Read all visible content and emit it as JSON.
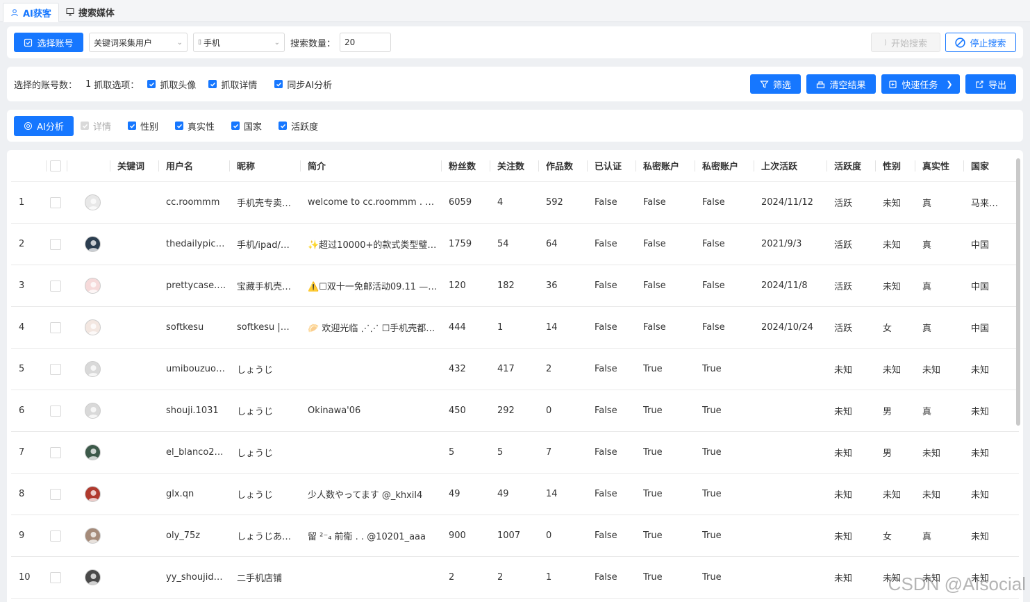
{
  "tabs": [
    {
      "label": "AI获客",
      "icon": "person-icon",
      "active": true
    },
    {
      "label": "搜索媒体",
      "icon": "monitor-icon",
      "active": false
    }
  ],
  "toolbar": {
    "select_account_label": "选择账号",
    "mode_select_value": "关键词采集用户",
    "device_select_value": "手机",
    "search_count_label": "搜索数量：",
    "search_count_value": "20",
    "start_search_label": "开始搜索",
    "stop_search_label": "停止搜索"
  },
  "options": {
    "selected_accounts_label": "选择的账号数：",
    "selected_accounts_value": "1",
    "capture_options_label": "抓取选项：",
    "capture_avatar": "抓取头像",
    "capture_details": "抓取详情",
    "sync_ai": "同步AI分析",
    "filter_label": "筛选",
    "clear_label": "清空结果",
    "quick_task_label": "快速任务",
    "export_label": "导出"
  },
  "ai_bar": {
    "ai_analysis_label": "AI分析",
    "details": "详情",
    "gender": "性别",
    "authenticity": "真实性",
    "country": "国家",
    "activity": "活跃度"
  },
  "table": {
    "headers": {
      "keyword": "关键词",
      "username": "用户名",
      "nickname": "昵称",
      "bio": "简介",
      "followers": "粉丝数",
      "following": "关注数",
      "works": "作品数",
      "verified": "已认证",
      "private1": "私密账户",
      "private2": "私密账户",
      "last_active": "上次活跃",
      "activity": "活跃度",
      "gender": "性别",
      "authenticity": "真实性",
      "country": "国家"
    },
    "rows": [
      {
        "idx": "1",
        "username": "cc.roommm",
        "nickname": "手机壳专卖…",
        "bio": "welcome to cc.roommm . We…",
        "followers": "6059",
        "following": "4",
        "works": "592",
        "verified": "False",
        "private1": "False",
        "private2": "False",
        "last_active": "2024/11/12",
        "activity": "活跃",
        "gender": "未知",
        "authenticity": "真",
        "country": "马来西亚",
        "avatar_color": "#e8e8e8"
      },
      {
        "idx": "2",
        "username": "thedailypic…",
        "nickname": "手机/ipad/…",
        "bio": "✨超过10000+的款式类型璧…",
        "followers": "1759",
        "following": "54",
        "works": "64",
        "verified": "False",
        "private1": "False",
        "private2": "False",
        "last_active": "2021/9/3",
        "activity": "活跃",
        "gender": "未知",
        "authenticity": "真",
        "country": "中国",
        "avatar_color": "#2c3e50"
      },
      {
        "idx": "3",
        "username": "prettycase.…",
        "nickname": "宝藏手机壳…",
        "bio": "⚠️☐双十一免邮活动09.11 —…",
        "followers": "120",
        "following": "182",
        "works": "36",
        "verified": "False",
        "private1": "False",
        "private2": "False",
        "last_active": "2024/11/8",
        "activity": "活跃",
        "gender": "未知",
        "authenticity": "真",
        "country": "中国",
        "avatar_color": "#f6dada"
      },
      {
        "idx": "4",
        "username": "softkesu",
        "nickname": "softkesu |…",
        "bio": "🥟 欢迎光临 ⋰⋰ ☐手机壳都…",
        "followers": "444",
        "following": "1",
        "works": "14",
        "verified": "False",
        "private1": "False",
        "private2": "False",
        "last_active": "2024/10/24",
        "activity": "活跃",
        "gender": "女",
        "authenticity": "真",
        "country": "中国",
        "avatar_color": "#f3e7e1"
      },
      {
        "idx": "5",
        "username": "umibouzuo…",
        "nickname": "しょうじ",
        "bio": "",
        "followers": "432",
        "following": "417",
        "works": "2",
        "verified": "False",
        "private1": "True",
        "private2": "True",
        "last_active": "",
        "activity": "未知",
        "gender": "未知",
        "authenticity": "未知",
        "country": "未知",
        "avatar_color": "#d9d9d9"
      },
      {
        "idx": "6",
        "username": "shouji.1031",
        "nickname": "しょうじ",
        "bio": "Okinawa'06",
        "followers": "450",
        "following": "292",
        "works": "0",
        "verified": "False",
        "private1": "True",
        "private2": "True",
        "last_active": "",
        "activity": "未知",
        "gender": "男",
        "authenticity": "真",
        "country": "未知",
        "avatar_color": "#d9d9d9"
      },
      {
        "idx": "7",
        "username": "el_blanco2…",
        "nickname": "しょうじ",
        "bio": "",
        "followers": "5",
        "following": "5",
        "works": "7",
        "verified": "False",
        "private1": "True",
        "private2": "True",
        "last_active": "",
        "activity": "未知",
        "gender": "男",
        "authenticity": "未知",
        "country": "未知",
        "avatar_color": "#3d5a4a"
      },
      {
        "idx": "8",
        "username": "glx.qn",
        "nickname": "しょうじ",
        "bio": "少人数やってます @_khxil4",
        "followers": "49",
        "following": "49",
        "works": "14",
        "verified": "False",
        "private1": "True",
        "private2": "True",
        "last_active": "",
        "activity": "未知",
        "gender": "未知",
        "authenticity": "未知",
        "country": "未知",
        "avatar_color": "#b03a2e"
      },
      {
        "idx": "9",
        "username": "oly_75z",
        "nickname": "しょうじあ…",
        "bio": "留 ²⁻₄  前衛 . . @10201_aaa",
        "followers": "900",
        "following": "1007",
        "works": "0",
        "verified": "False",
        "private1": "True",
        "private2": "True",
        "last_active": "",
        "activity": "未知",
        "gender": "女",
        "authenticity": "真",
        "country": "未知",
        "avatar_color": "#a58b7a"
      },
      {
        "idx": "10",
        "username": "yy_shoujid…",
        "nickname": "二手机店铺",
        "bio": "",
        "followers": "2",
        "following": "2",
        "works": "1",
        "verified": "False",
        "private1": "True",
        "private2": "True",
        "last_active": "",
        "activity": "未知",
        "gender": "未知",
        "authenticity": "未知",
        "country": "未知",
        "avatar_color": "#4a4a4a"
      }
    ]
  },
  "watermark": "CSDN @AIsocial"
}
